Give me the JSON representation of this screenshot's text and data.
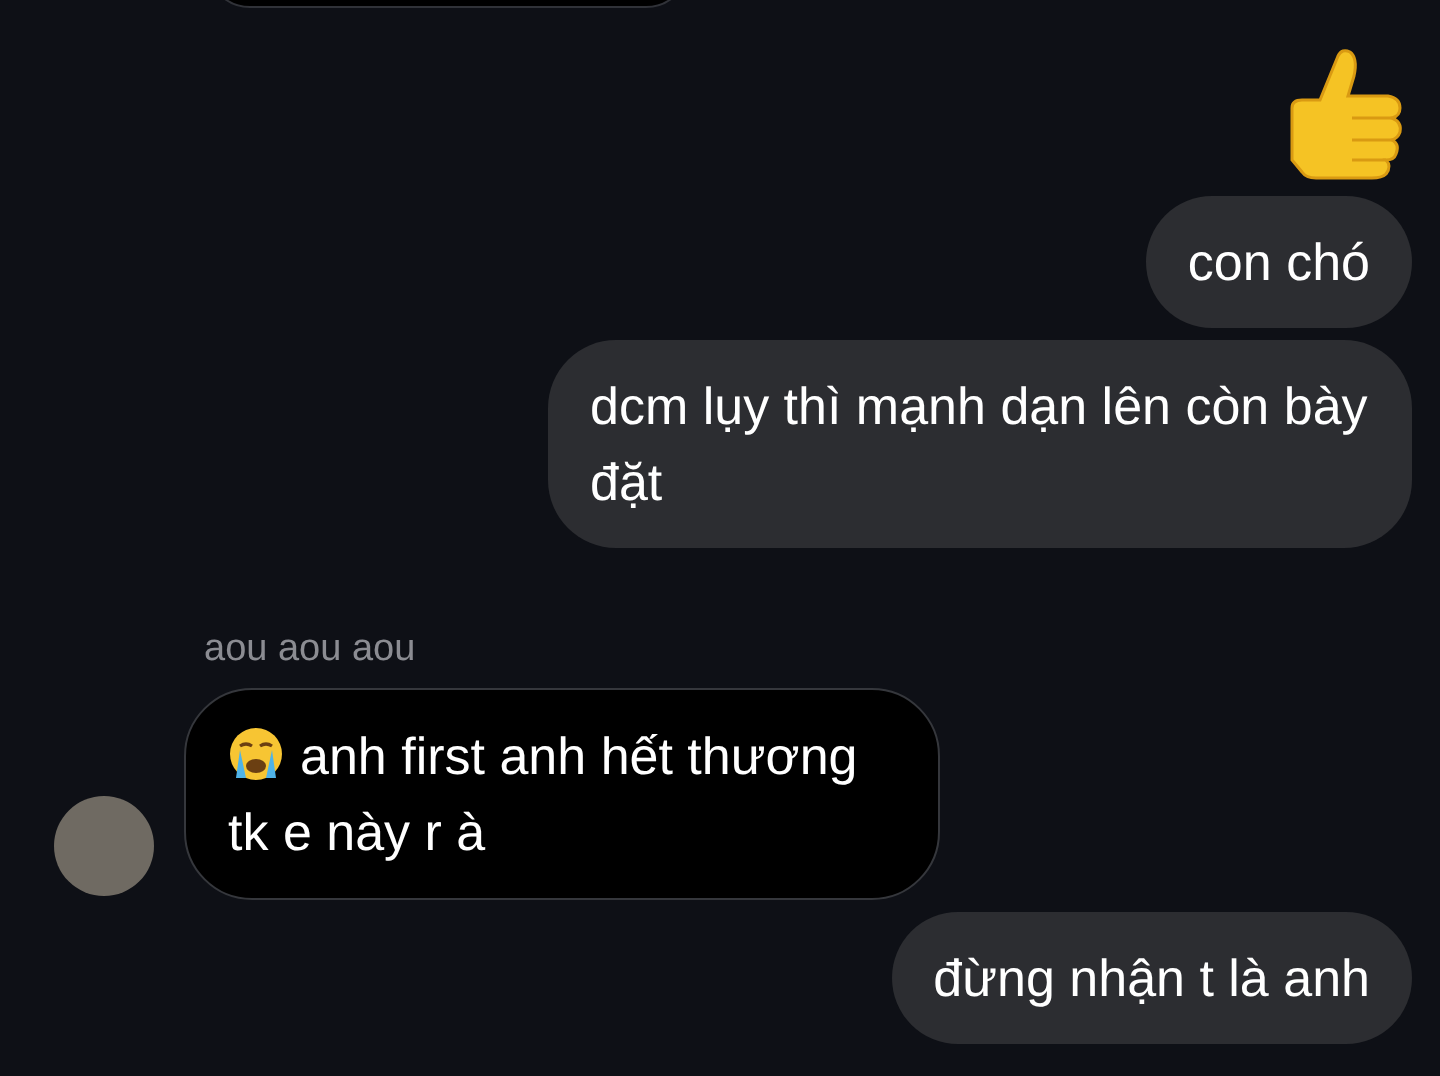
{
  "messages": [
    {
      "kind": "thumbs_up"
    },
    {
      "kind": "sent",
      "text": "con chó"
    },
    {
      "kind": "sent",
      "text": "dcm lụy thì mạnh dạn lên còn bày đặt"
    },
    {
      "kind": "received",
      "sender": "aou aou aou",
      "crying_emoji": true,
      "text": "anh first anh hết thương tk e này r à"
    },
    {
      "kind": "sent",
      "text": "đừng nhận t là anh"
    }
  ]
}
